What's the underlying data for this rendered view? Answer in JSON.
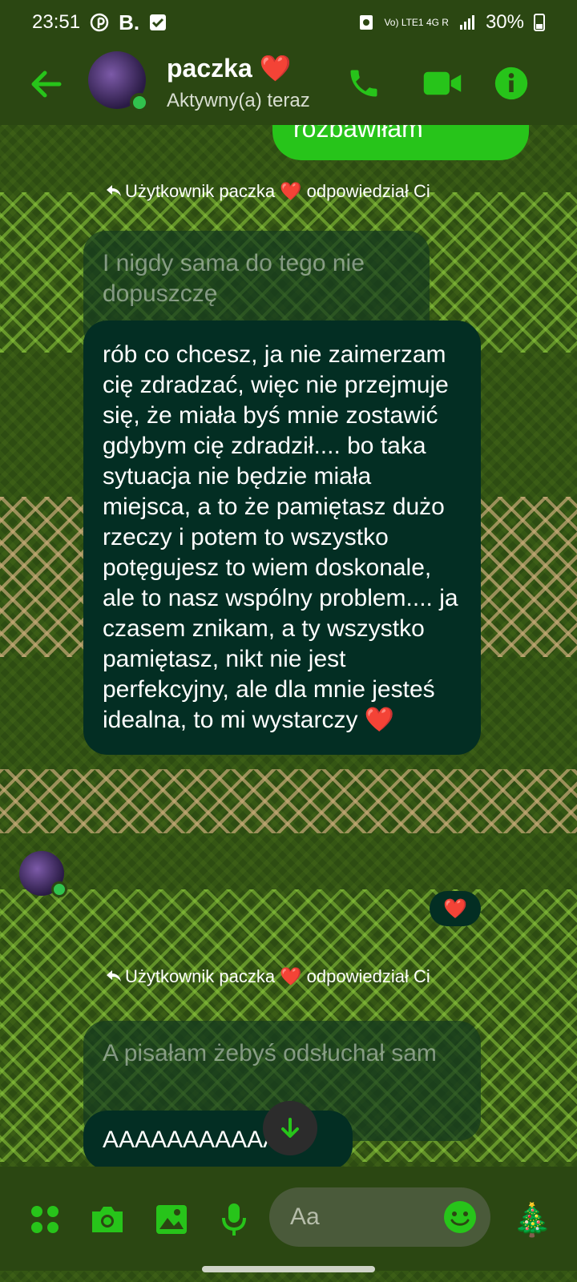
{
  "status_bar": {
    "time": "23:51",
    "left_icons": [
      "pinterest-icon",
      "booking-icon",
      "check-box-icon"
    ],
    "network": "Vo) LTE1 4G R",
    "battery": "30%"
  },
  "header": {
    "name": "paczka ❤️",
    "status": "Aktywny(a) teraz",
    "accent_color": "#27c41a"
  },
  "messages": {
    "outgoing_partial": "rozbawiłam",
    "reply_1": "Użytkownik paczka ❤️ odpowiedział Ci",
    "quoted_1": "I nigdy sama do tego nie dopuszczę",
    "message_1": "rób co chcesz, ja nie zaimerzam cię zdradzać, więc nie przejmuje się, że miała byś mnie zostawić gdybym cię zdradził.... bo taka sytuacja nie będzie miała miejsca, a to że pamiętasz dużo rzeczy i potem to wszystko potęgujesz to wiem doskonale, ale to nasz wspólny problem.... ja czasem znikam, a ty wszystko pamiętasz, nikt nie jest perfekcyjny, ale dla mnie jesteś idealna, to mi wystarczy ❤️",
    "reaction_1": "❤️",
    "reply_2": "Użytkownik paczka ❤️ odpowiedział Ci",
    "quoted_2": "A pisałam żebyś odsłuchał sam",
    "message_2": "AAAAAAAAAAAaa"
  },
  "composer": {
    "placeholder": "Aa",
    "sticker": "🎄"
  }
}
